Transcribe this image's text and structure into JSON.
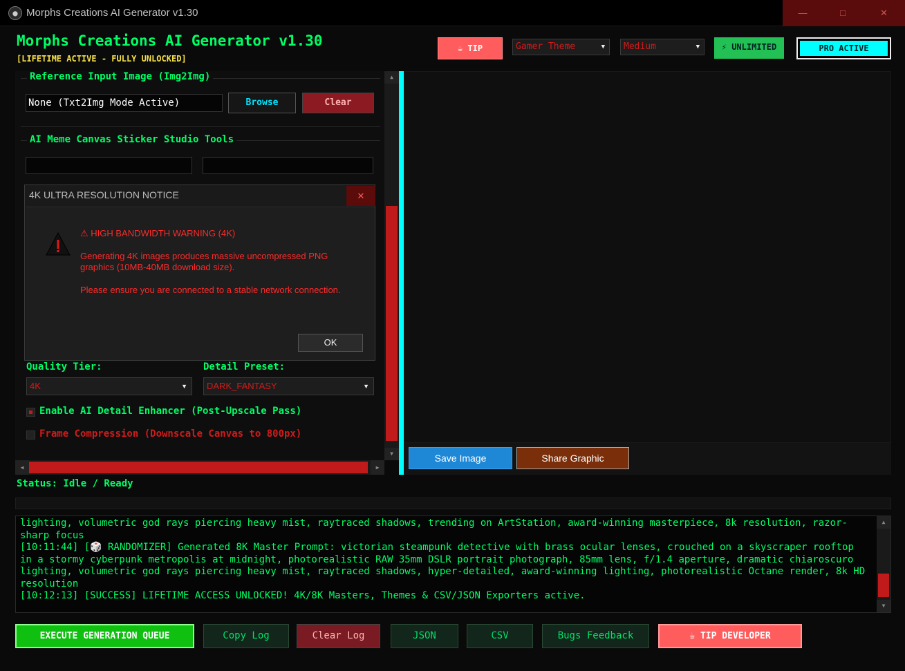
{
  "window": {
    "title": "Morphs Creations AI Generator v1.30",
    "min": "—",
    "max": "□",
    "close": "✕"
  },
  "header": {
    "heading": "Morphs Creations AI Generator v1.30",
    "subheading": "[LIFETIME ACTIVE - FULLY UNLOCKED]",
    "tip_label": "☕ TIP",
    "theme_value": "Gamer Theme",
    "size_value": "Medium",
    "unlimited_label": "⚡ UNLIMITED",
    "pro_label": "PRO ACTIVE"
  },
  "reference": {
    "group_title": "Reference Input Image (Img2Img)",
    "input_value": "None (Txt2Img Mode Active)",
    "browse_label": "Browse",
    "clear_label": "Clear"
  },
  "sticker_tools": {
    "group_title": "AI Meme Canvas Sticker Studio Tools"
  },
  "quality": {
    "quality_label": "Quality Tier:",
    "quality_value": "4K",
    "preset_label": "Detail Preset:",
    "preset_value": "DARK_FANTASY",
    "enhancer_label": "Enable AI Detail Enhancer (Post-Upscale Pass)",
    "enhancer_checked": true,
    "compression_label": "Frame Compression (Downscale Canvas to 800px)",
    "compression_checked": false
  },
  "preview": {
    "save_label": "Save Image",
    "share_label": "Share Graphic"
  },
  "status": {
    "text": "Status: Idle / Ready"
  },
  "log": {
    "text": "lighting, volumetric god rays piercing heavy mist, raytraced shadows, trending on ArtStation, award-winning masterpiece, 8k resolution, razor-sharp focus\n[10:11:44] [🎲 RANDOMIZER] Generated 8K Master Prompt: victorian steampunk detective with brass ocular lenses, crouched on a skyscraper rooftop in a stormy cyberpunk metropolis at midnight, photorealistic RAW 35mm DSLR portrait photograph, 85mm lens, f/1.4 aperture, dramatic chiaroscuro lighting, volumetric god rays piercing heavy mist, raytraced shadows, hyper-detailed, award-winning lighting, photorealistic Octane render, 8k HD resolution\n[10:12:13] [SUCCESS] LIFETIME ACCESS UNLOCKED! 4K/8K Masters, Themes & CSV/JSON Exporters active."
  },
  "actions": {
    "execute_label": "EXECUTE GENERATION QUEUE",
    "copy_log_label": "Copy Log",
    "clear_log_label": "Clear Log",
    "json_label": "JSON",
    "csv_label": "CSV",
    "bugs_label": "Bugs Feedback",
    "tip_dev_label": "☕ TIP DEVELOPER"
  },
  "dialog": {
    "title": "4K ULTRA RESOLUTION NOTICE",
    "close": "✕",
    "heading": "⚠ HIGH BANDWIDTH WARNING (4K)",
    "line1": "Generating 4K images produces massive uncompressed PNG graphics (10MB-40MB download size).",
    "line2": "Please ensure you are connected to a stable network connection.",
    "ok_label": "OK"
  },
  "colors": {
    "accent_green": "#00ff66",
    "accent_cyan": "#00ffff",
    "danger_red": "#d21b1b",
    "tip_coral": "#ff5d5d"
  }
}
